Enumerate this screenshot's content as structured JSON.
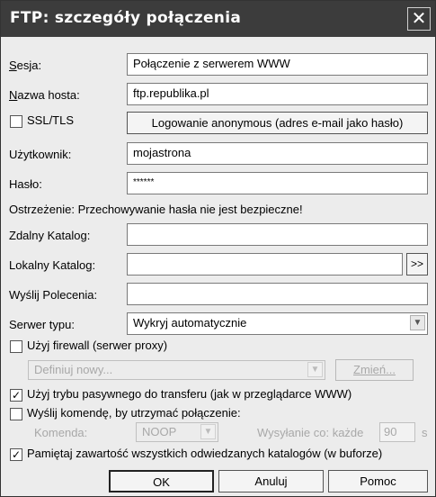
{
  "window": {
    "title": "FTP: szczegóły połączenia",
    "close_glyph": "✕"
  },
  "fields": {
    "session_label": "Sesja:",
    "session_value": "Połączenie z serwerem WWW",
    "host_label": "Nazwa hosta:",
    "host_value": "ftp.republika.pl",
    "ssl_label": "SSL/TLS",
    "ssl_checked": false,
    "anonymous_button": "Logowanie anonymous (adres e-mail jako hasło)",
    "user_label": "Użytkownik:",
    "user_value": "mojastrona",
    "password_label": "Hasło:",
    "password_value": "******",
    "warning": "Ostrzeżenie: Przechowywanie hasła nie jest bezpieczne!",
    "remote_dir_label": "Zdalny Katalog:",
    "remote_dir_value": "",
    "local_dir_label": "Lokalny Katalog:",
    "local_dir_value": "",
    "browse_button": ">>",
    "commands_label": "Wyślij Polecenia:",
    "commands_value": "",
    "server_type_label": "Serwer typu:",
    "server_type_value": "Wykryj automatycznie"
  },
  "firewall": {
    "label": "Użyj firewall (serwer proxy)",
    "checked": false,
    "select_value": "Definiuj nowy...",
    "change_button": "Zmień..."
  },
  "passive": {
    "label": "Użyj trybu pasywnego do transferu (jak w przeglądarce WWW)",
    "checked": true
  },
  "keepalive": {
    "label": "Wyślij komendę, by utrzymać połączenie:",
    "checked": false,
    "command_label": "Komenda:",
    "command_value": "NOOP",
    "interval_label": "Wysyłanie co: każde",
    "interval_value": "90",
    "unit": "s"
  },
  "cache": {
    "label": "Pamiętaj zawartość wszystkich odwiedzanych katalogów (w buforze)",
    "checked": true
  },
  "buttons": {
    "ok": "OK",
    "cancel": "Anuluj",
    "help": "Pomoc"
  },
  "icons": {
    "check": "✓",
    "dropdown": "▼"
  }
}
